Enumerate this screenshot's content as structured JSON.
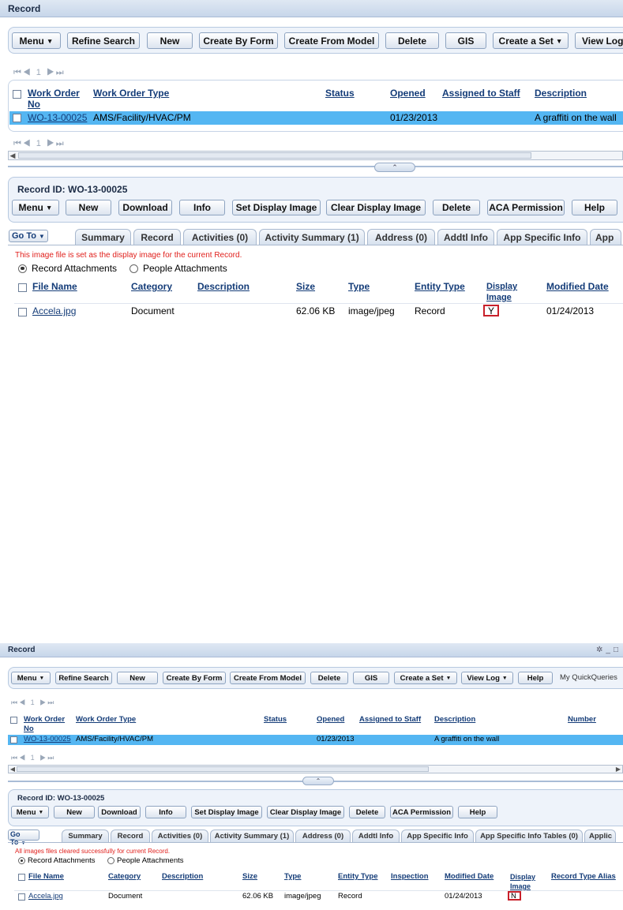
{
  "top": {
    "title": "Record",
    "toolbar": [
      "Menu",
      "Refine Search",
      "New",
      "Create By Form",
      "Create From Model",
      "Delete",
      "GIS",
      "Create a Set",
      "View Log"
    ],
    "pager_page": "1",
    "table": {
      "headers": [
        "Work Order No",
        "Work Order Type",
        "Status",
        "Opened",
        "Assigned to Staff",
        "Description"
      ],
      "row": {
        "no": "WO-13-00025",
        "type": "AMS/Facility/HVAC/PM",
        "status": "",
        "opened": "01/23/2013",
        "staff": "",
        "description": "A graffiti on the wall"
      }
    },
    "record_id": "Record ID: WO-13-00025",
    "record_toolbar": [
      "Menu",
      "New",
      "Download",
      "Info",
      "Set Display Image",
      "Clear Display Image",
      "Delete",
      "ACA Permission",
      "Help"
    ],
    "goto": "Go To",
    "tabs": [
      "Summary",
      "Record",
      "Activities (0)",
      "Activity Summary (1)",
      "Address (0)",
      "Addtl Info",
      "App Specific Info",
      "App"
    ],
    "message": "This image file is set as the display image for the current Record.",
    "radios": [
      "Record Attachments",
      "People Attachments"
    ],
    "att_headers": [
      "File Name",
      "Category",
      "Description",
      "Size",
      "Type",
      "Entity Type",
      "Display Image",
      "Modified Date"
    ],
    "att_row": {
      "file": "Accela.jpg",
      "category": "Document",
      "description": "",
      "size": "62.06 KB",
      "type": "image/jpeg",
      "entity": "Record",
      "display": "Y",
      "modified": "01/24/2013"
    }
  },
  "bottom": {
    "title": "Record",
    "toolbar": [
      "Menu",
      "Refine Search",
      "New",
      "Create By Form",
      "Create From Model",
      "Delete",
      "GIS",
      "Create a Set",
      "View Log",
      "Help"
    ],
    "quick_queries": "My QuickQueries",
    "pager_page": "1",
    "table": {
      "headers": [
        "Work Order No",
        "Work Order Type",
        "Status",
        "Opened",
        "Assigned to Staff",
        "Description",
        "Number"
      ],
      "row": {
        "no": "WO-13-00025",
        "type": "AMS/Facility/HVAC/PM",
        "status": "",
        "opened": "01/23/2013",
        "staff": "",
        "description": "A graffiti on the wall",
        "number": ""
      }
    },
    "record_id": "Record ID: WO-13-00025",
    "record_toolbar": [
      "Menu",
      "New",
      "Download",
      "Info",
      "Set Display Image",
      "Clear Display Image",
      "Delete",
      "ACA Permission",
      "Help"
    ],
    "goto": "Go To",
    "tabs": [
      "Summary",
      "Record",
      "Activities (0)",
      "Activity Summary (1)",
      "Address (0)",
      "Addtl Info",
      "App Specific Info",
      "App Specific Info Tables (0)",
      "Applic"
    ],
    "message": "All images files cleared successfully for current Record.",
    "radios": [
      "Record Attachments",
      "People Attachments"
    ],
    "att_headers": [
      "File Name",
      "Category",
      "Description",
      "Size",
      "Type",
      "Entity Type",
      "Inspection",
      "Modified Date",
      "Display Image",
      "Record Type Alias"
    ],
    "att_row": {
      "file": "Accela.jpg",
      "category": "Document",
      "description": "",
      "size": "62.06 KB",
      "type": "image/jpeg",
      "entity": "Record",
      "inspection": "",
      "modified": "01/24/2013",
      "display": "N",
      "alias": ""
    }
  }
}
